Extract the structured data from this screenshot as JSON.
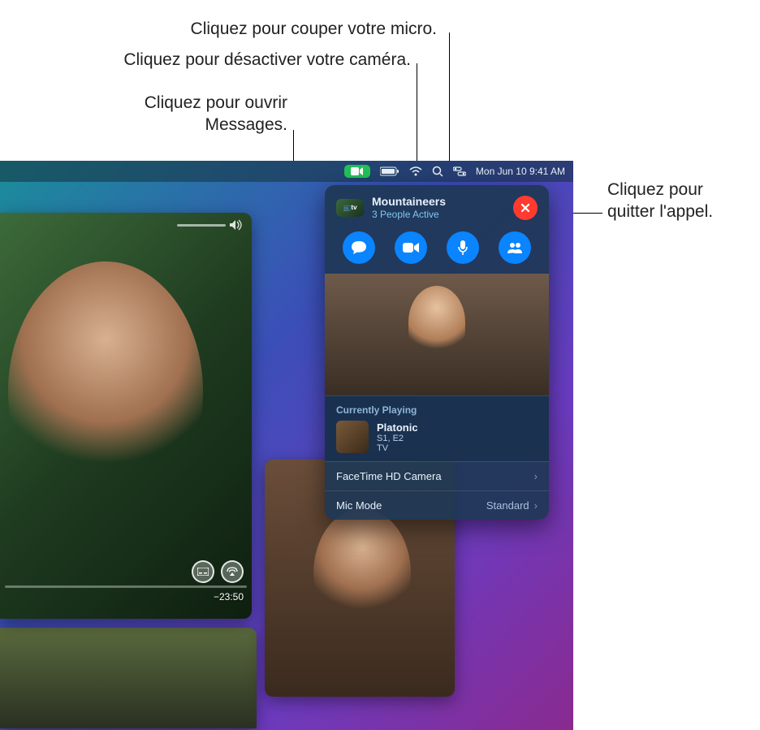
{
  "callouts": {
    "mute_mic": "Cliquez pour couper votre micro.",
    "disable_cam": "Cliquez pour désactiver votre caméra.",
    "open_messages_l1": "Cliquez pour ouvrir",
    "open_messages_l2": "Messages.",
    "leave_call_l1": "Cliquez pour",
    "leave_call_l2": "quitter l'appel."
  },
  "menubar": {
    "datetime": "Mon Jun 10  9:41 AM"
  },
  "hud": {
    "title": "Mountaineers",
    "subtitle": "3 People Active",
    "avatar_tag": "📺tv",
    "currently_playing_label": "Currently Playing",
    "media_title": "Platonic",
    "media_sub1": "S1, E2",
    "media_sub2": "TV",
    "camera_row_label": "FaceTime HD Camera",
    "mic_mode_label": "Mic Mode",
    "mic_mode_value": "Standard"
  },
  "player": {
    "time_remaining": "−23:50"
  }
}
